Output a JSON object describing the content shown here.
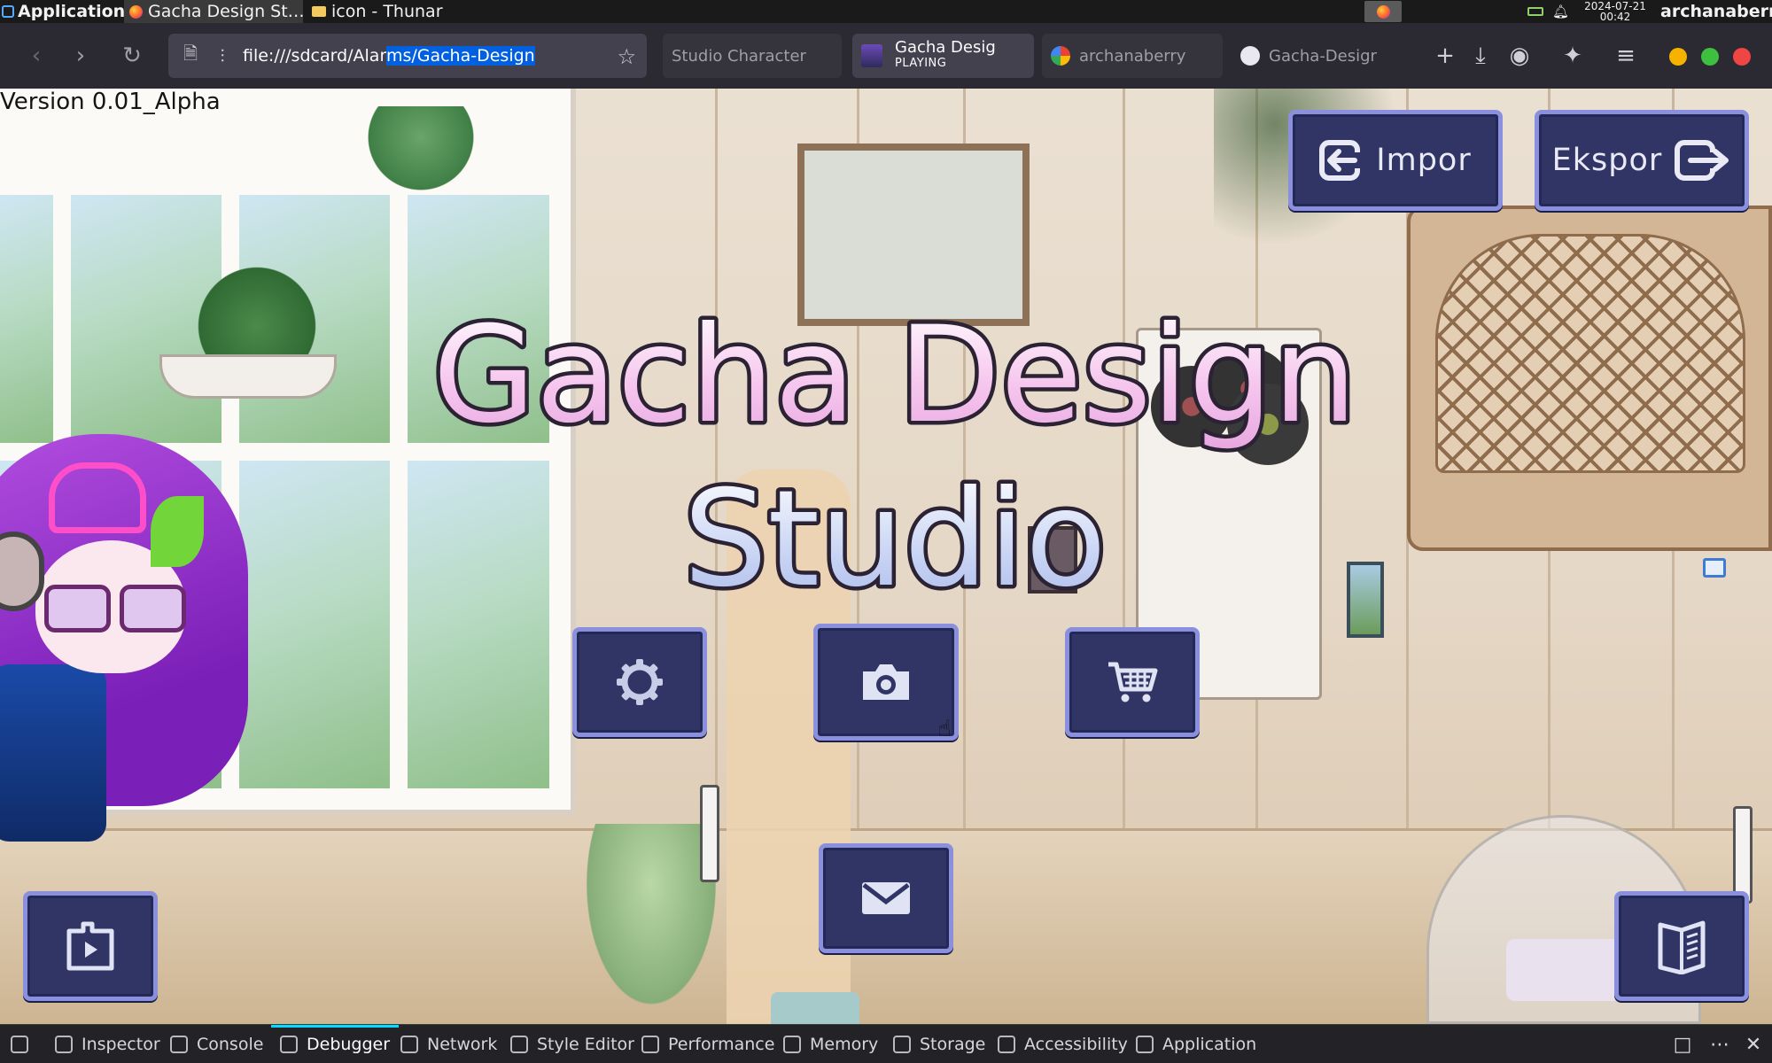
{
  "os_panel": {
    "applications_label": "Applications",
    "tasks": [
      {
        "label": "Gacha Design St…"
      },
      {
        "label": "icon - Thunar"
      }
    ],
    "clock_date": "2024-07-21",
    "clock_time": "00:42",
    "user": "archanaberry"
  },
  "browser": {
    "url_prefix": "file:///sdcard/Alar",
    "url_selected": "ms/Gacha-Design-S",
    "tabs": [
      {
        "label": "Studio Character"
      },
      {
        "label": "Gacha Desig",
        "sublabel": "PLAYING"
      },
      {
        "label": "archanaberry"
      },
      {
        "label": "Gacha-Desigr"
      }
    ],
    "icons": [
      "back-icon",
      "forward-icon",
      "reload-icon",
      "page-icon",
      "permissions-icon",
      "bookmark-star-icon",
      "new-tab-icon",
      "download-icon",
      "account-icon",
      "extensions-icon",
      "menu-icon"
    ],
    "window_controls": {
      "minimize": "#f5b300",
      "maximize": "#3fbf3f",
      "close": "#f04545"
    }
  },
  "game": {
    "version": "Version 0.01_Alpha",
    "title_line1": "Gacha Design",
    "title_line2": "Studio",
    "import_label": "Impor",
    "export_label": "Ekspor",
    "colors": {
      "button_fill": "#303565",
      "button_border": "#8a90dd",
      "title_pink": "#f6c7ee",
      "title_blue": "#cdd8f5",
      "title_outline": "#2b2233"
    },
    "buttons": [
      {
        "name": "settings-button",
        "icon": "gear-icon"
      },
      {
        "name": "camera-button",
        "icon": "camera-icon"
      },
      {
        "name": "shop-button",
        "icon": "cart-icon"
      },
      {
        "name": "mail-button",
        "icon": "mail-icon"
      },
      {
        "name": "gallery-button",
        "icon": "play-folder-icon"
      },
      {
        "name": "book-button",
        "icon": "book-icon"
      }
    ]
  },
  "devtools": {
    "tabs": [
      {
        "label": "Inspector"
      },
      {
        "label": "Console"
      },
      {
        "label": "Debugger",
        "active": true
      },
      {
        "label": "Network"
      },
      {
        "label": "Style Editor"
      },
      {
        "label": "Performance"
      },
      {
        "label": "Memory"
      },
      {
        "label": "Storage"
      },
      {
        "label": "Accessibility"
      },
      {
        "label": "Application"
      }
    ]
  }
}
